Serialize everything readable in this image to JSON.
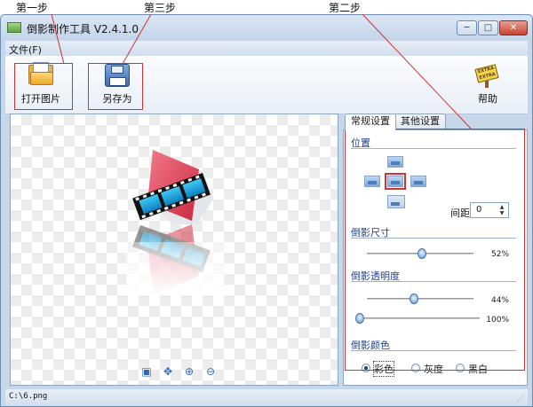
{
  "annotations": {
    "step1": "第一步",
    "step2": "第二步",
    "step3": "第三步"
  },
  "window": {
    "title": "倒影制作工具 V2.4.1.0",
    "minimize_glyph": "─",
    "maximize_glyph": "□",
    "close_glyph": "✕"
  },
  "menu": {
    "file": "文件(F)"
  },
  "toolbar": {
    "open_label": "打开图片",
    "save_as_label": "另存为",
    "help_label": "帮助",
    "help_sign_text": "EXTRA EXTRA"
  },
  "zoom_icons": {
    "fit": "▣",
    "actual": "✥",
    "zoom_in": "⊕",
    "zoom_out": "⊖"
  },
  "tabs": {
    "general": "常规设置",
    "other": "其他设置"
  },
  "position": {
    "title": "位置",
    "spacing_label": "间距",
    "spacing_value": "0",
    "spinner_up": "▲",
    "spinner_down": "▼"
  },
  "reflection_size": {
    "title": "倒影尺寸",
    "percent_text": "52%",
    "value": 52
  },
  "reflection_opacity": {
    "title": "倒影透明度",
    "start_percent_text": "44%",
    "start_value": 44,
    "end_percent_text": "100%",
    "end_value": 100
  },
  "reflection_color": {
    "title": "倒影颜色",
    "options": [
      "彩色",
      "灰度",
      "黑白"
    ],
    "selected": "彩色"
  },
  "status": {
    "path": "C:\\6.png",
    "grip_glyph": "⋰"
  },
  "colors": {
    "accent": "#d33232",
    "title_blue": "#1c3f8f",
    "window_frame": "#c7d7ea"
  }
}
